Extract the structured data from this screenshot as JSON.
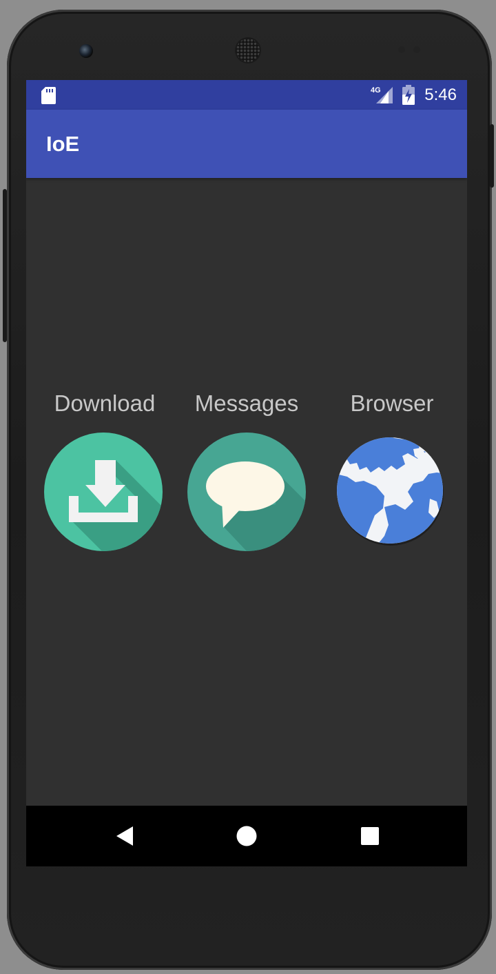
{
  "status_bar": {
    "time": "5:46",
    "network_label": "4G",
    "icons": [
      "sd-card-icon",
      "signal-icon",
      "battery-charging-icon"
    ]
  },
  "app_bar": {
    "title": "IoE"
  },
  "tiles": [
    {
      "label": "Download",
      "icon": "download-icon"
    },
    {
      "label": "Messages",
      "icon": "chat-bubble-icon"
    },
    {
      "label": "Browser",
      "icon": "globe-icon"
    }
  ],
  "nav_bar": {
    "buttons": [
      "back-icon",
      "home-icon",
      "recents-icon"
    ]
  },
  "colors": {
    "status_bar": "#303f9f",
    "app_bar": "#3f51b5",
    "background": "#303030",
    "download_green": "#4cc3a2",
    "messages_teal": "#47a693",
    "globe_blue": "#4a7fd9"
  }
}
